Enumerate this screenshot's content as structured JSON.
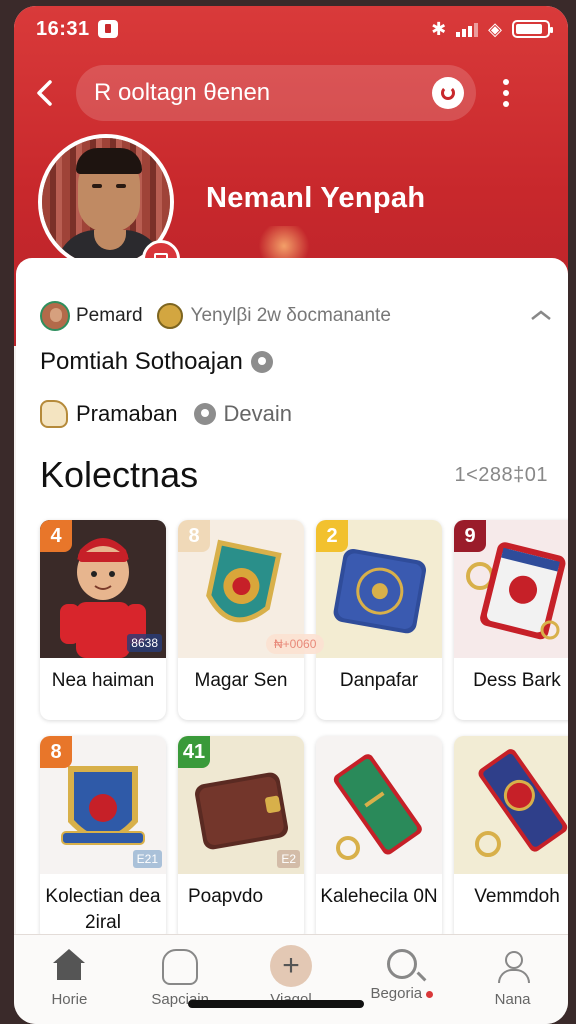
{
  "status_bar": {
    "time": "16:31"
  },
  "header": {
    "search_text": "R οoltagn θenen",
    "profile_name": "Nemanl Yenpah"
  },
  "profile": {
    "meta_name": "Pemard",
    "meta_sub": "Yenylβi 2w δocmanante",
    "line2": "Pomtiah Sothoajan",
    "line3_text": "Pramaban",
    "line3_location": "Devain"
  },
  "collection": {
    "title": "Kolectnas",
    "count": "1<288‡01",
    "items": [
      {
        "num": "4",
        "label": "Nea haiman",
        "badge_color": "#e8762a",
        "tag": "8638"
      },
      {
        "num": "8",
        "label": "Magar Sen",
        "badge_color": "#f0d9b8",
        "tag": ""
      },
      {
        "num": "2",
        "label": "Danpafar",
        "badge_color": "#f2c12e",
        "tag": ""
      },
      {
        "num": "9",
        "label": "Dess Bark",
        "badge_color": "#9a1c2a",
        "tag": ""
      },
      {
        "num": "8",
        "label": "Kolectian dea 2iral",
        "badge_color": "#e8762a",
        "tag": "E21"
      },
      {
        "num": "41",
        "label": "Poapvdo",
        "badge_color": "#3a9a3a",
        "tag": "E2"
      },
      {
        "num": "",
        "label": "Kalehecila 0N",
        "badge_color": "",
        "tag": ""
      },
      {
        "num": "",
        "label": "Vemmdoh",
        "badge_color": "",
        "tag": ""
      }
    ],
    "price_chip": "₦+0060"
  },
  "nav": {
    "items": [
      {
        "label": "Horie",
        "icon": "home-icon"
      },
      {
        "label": "Sapciain",
        "icon": "bag-icon"
      },
      {
        "label": "Viagol",
        "icon": "plus-icon"
      },
      {
        "label": "Begoria",
        "icon": "search-icon"
      },
      {
        "label": "Nana",
        "icon": "user-icon"
      }
    ]
  }
}
